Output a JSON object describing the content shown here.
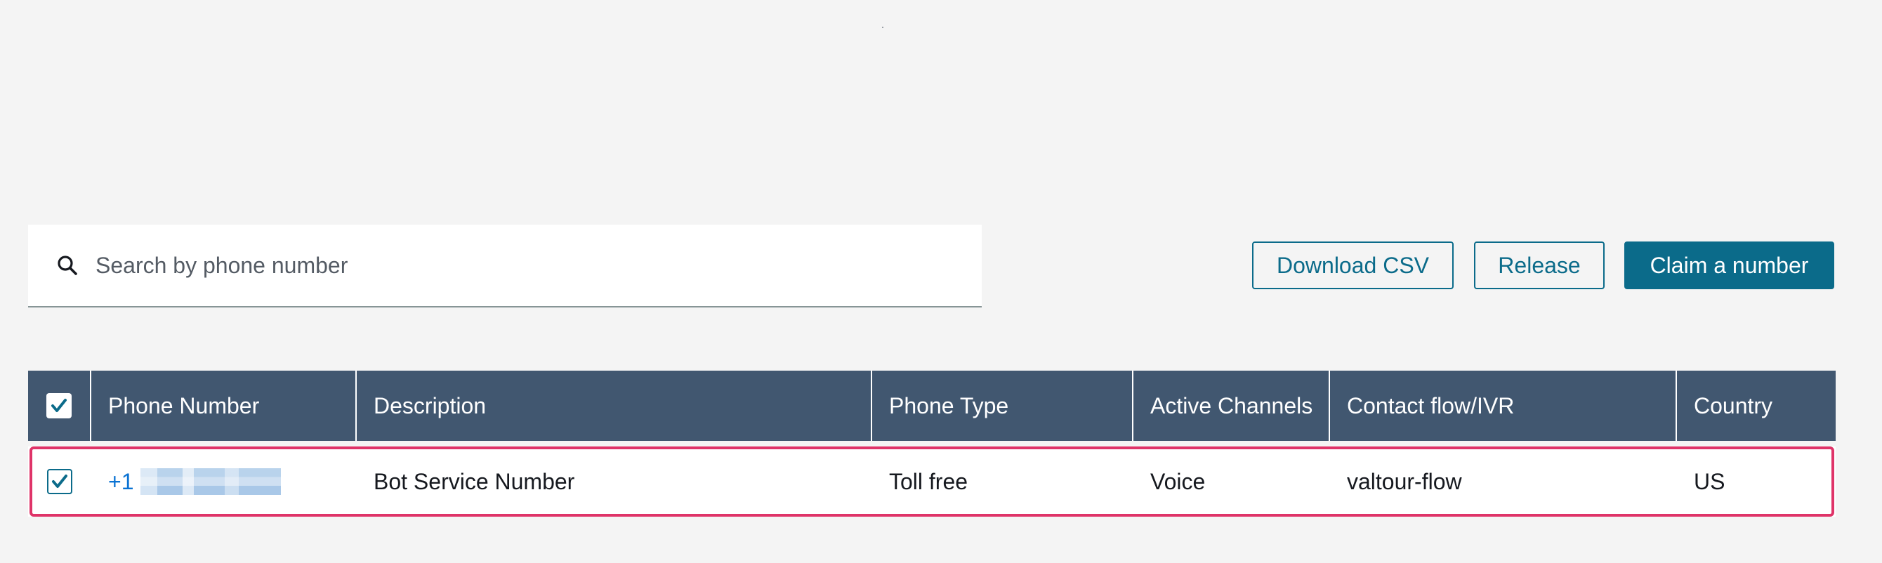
{
  "search": {
    "placeholder": "Search by phone number",
    "value": ""
  },
  "actions": {
    "download_csv": "Download CSV",
    "release": "Release",
    "claim": "Claim a number"
  },
  "colors": {
    "header_bg": "#415770",
    "primary": "#0b6b8a",
    "link": "#0972d3",
    "row_highlight": "#df3368",
    "page_bg": "#f4f4f4"
  },
  "table": {
    "select_all_checked": true,
    "columns": [
      "Phone Number",
      "Description",
      "Phone Type",
      "Active Channels",
      "Contact flow/IVR",
      "Country"
    ],
    "rows": [
      {
        "checked": true,
        "phone_number": "+1",
        "phone_redacted": true,
        "description": "Bot Service Number",
        "phone_type": "Toll free",
        "active_channels": "Voice",
        "contact_flow": "valtour-flow",
        "country": "US"
      }
    ]
  },
  "icons": {
    "search": "search-icon",
    "check": "checkmark-icon"
  }
}
